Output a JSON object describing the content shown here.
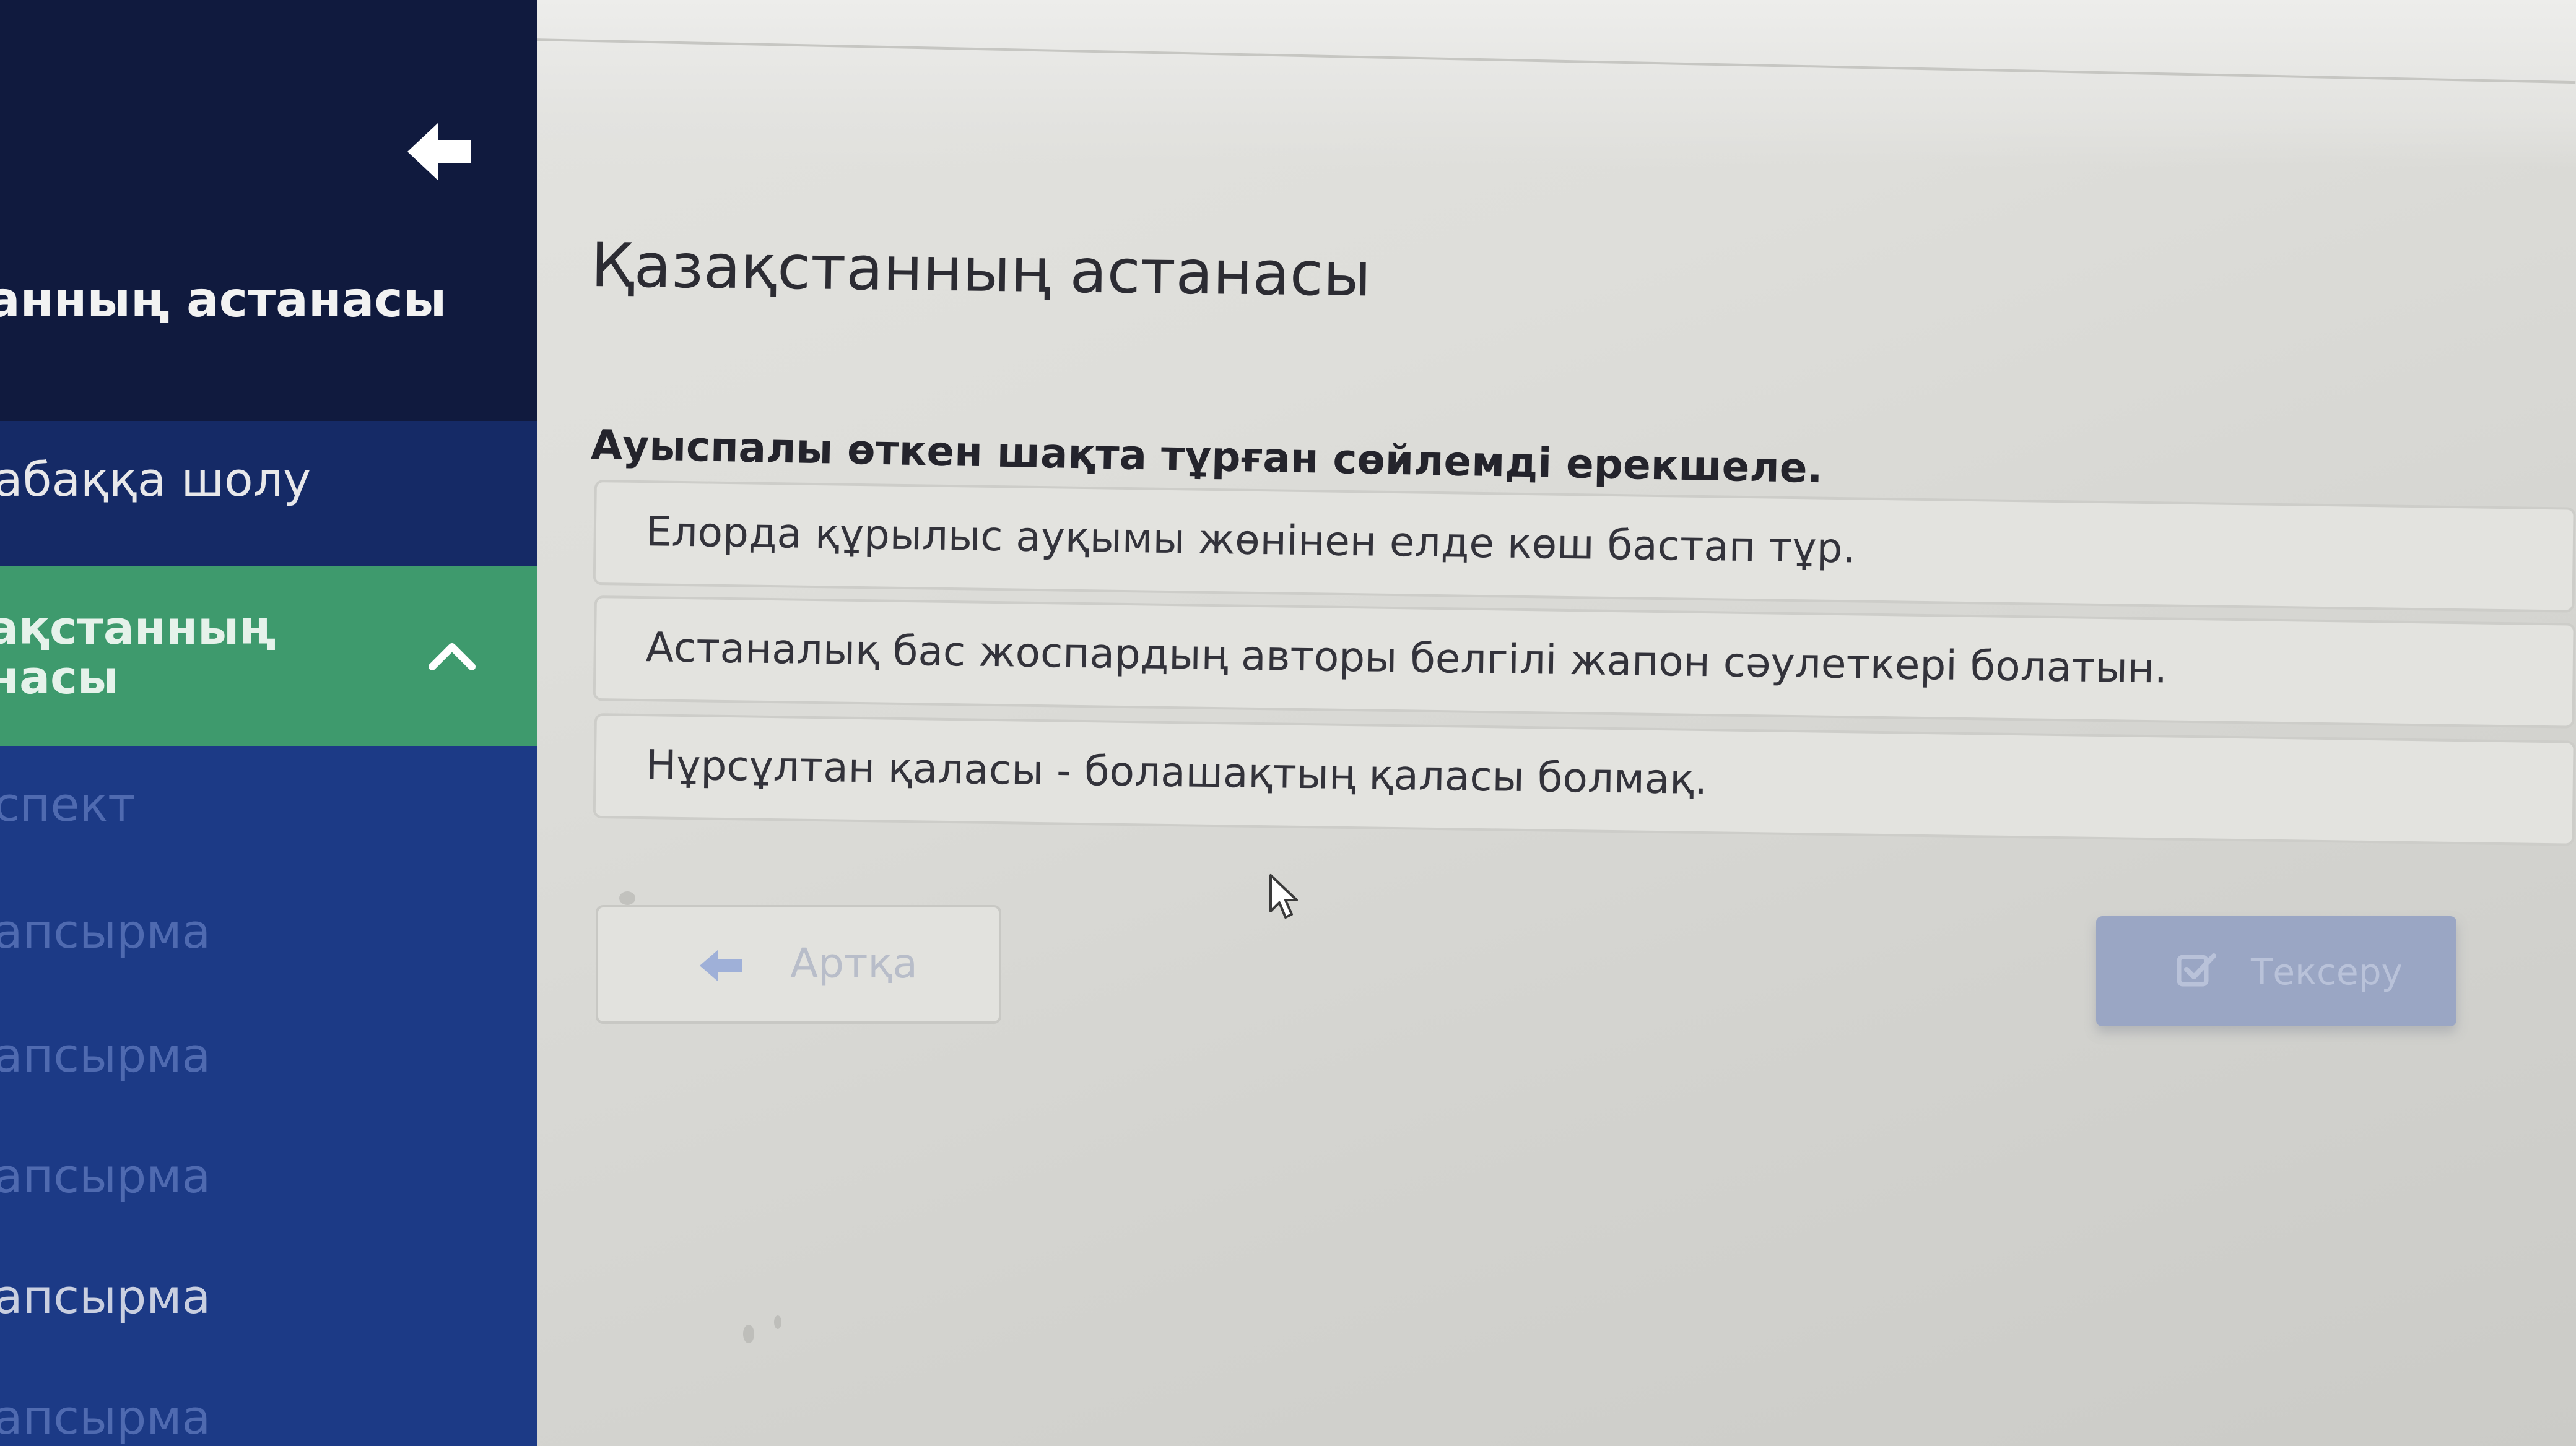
{
  "sidebar": {
    "course_title": "анның астанасы",
    "overview_item": "абаққа шолу",
    "active_item": "ақстанның\nнасы",
    "sub_items": [
      "спект",
      "апсырма",
      "апсырма",
      "апсырма",
      "апсырма",
      "апсырма"
    ]
  },
  "main": {
    "page_title": "Қазақстанның астанасы",
    "question": "Ауыспалы өткен шақта тұрған сөйлемді ерекшеле.",
    "options": [
      "Елорда құрылыс ауқымы жөнінен елде көш бастап тұр.",
      "Астаналық бас жоспардың авторы белгілі жапон сәулеткері болатын.",
      "Нұрсұлтан қаласы - болашақтың қаласы болмақ."
    ],
    "back_button_label": "Артқа",
    "check_button_label": "Тексеру"
  },
  "colors": {
    "sidebar_dark": "#101a3e",
    "sidebar_blue": "#1c3a86",
    "active_green": "#3e9a6d",
    "check_button": "#9aa6c4"
  },
  "icons": {
    "sidebar_back": "arrow-left-icon",
    "expand": "chevron-up-icon",
    "back_button": "arrow-left-icon",
    "check_button": "check-square-icon",
    "cursor": "mouse-pointer-icon"
  }
}
